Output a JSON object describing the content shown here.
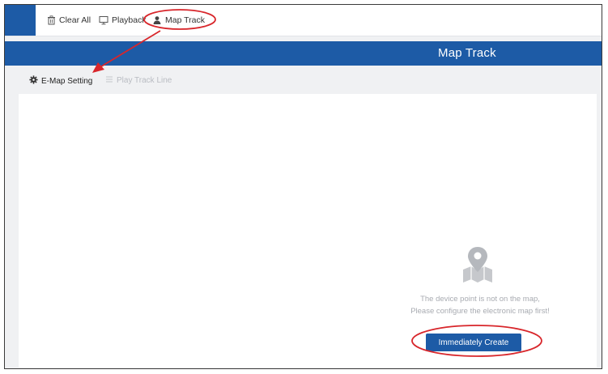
{
  "toolbar": {
    "clear_all": "Clear All",
    "playback": "Playback",
    "map_track": "Map Track"
  },
  "header": {
    "title": "Map Track"
  },
  "subtoolbar": {
    "emap_setting": "E-Map Setting",
    "play_track_line": "Play Track Line"
  },
  "empty_state": {
    "line1": "The device point is not on the map,",
    "line2": "Please configure the electronic map first!",
    "create_button": "Immediately Create"
  },
  "colors": {
    "brand_blue": "#1d5ba6",
    "annotation_red": "#d8262b",
    "disabled_text": "#b9bcc2"
  },
  "icons": {
    "clear_all": "trash-icon",
    "playback": "monitor-icon",
    "map_track": "person-pin-icon",
    "emap_setting": "gear-icon",
    "play_track_line": "list-icon",
    "empty_state": "map-pin-icon"
  }
}
